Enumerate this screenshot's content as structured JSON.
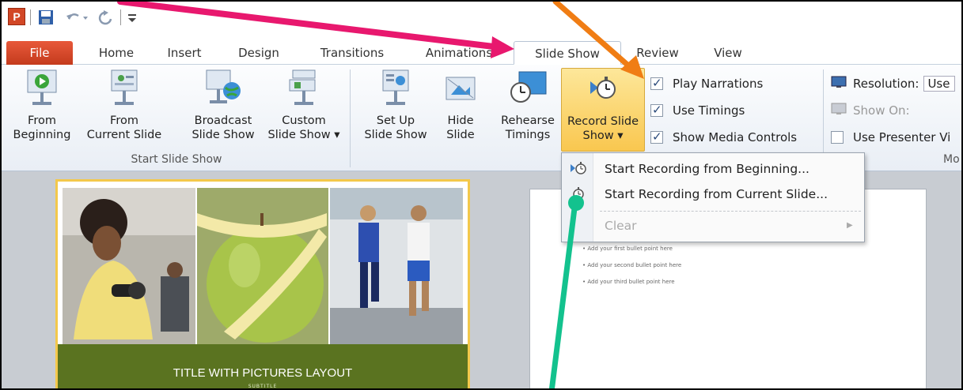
{
  "colors": {
    "arrow_pink": "#e8186e",
    "arrow_orange": "#f07d14",
    "arrow_green": "#13c28e",
    "record_highlight": "#f9c74f",
    "file_tab": "#d24726",
    "slide_banner": "#5a7320"
  },
  "qat": {
    "app_icon_letter": "P",
    "icons": [
      "powerpoint-icon",
      "save-icon",
      "undo-icon",
      "redo-icon",
      "customize-qat-icon"
    ]
  },
  "tabs": [
    {
      "label": "File"
    },
    {
      "label": "Home"
    },
    {
      "label": "Insert"
    },
    {
      "label": "Design"
    },
    {
      "label": "Transitions"
    },
    {
      "label": "Animations"
    },
    {
      "label": "Slide Show",
      "active": true
    },
    {
      "label": "Review"
    },
    {
      "label": "View"
    }
  ],
  "ribbon": {
    "start_group": {
      "label": "Start Slide Show",
      "buttons": [
        {
          "line1": "From",
          "line2": "Beginning"
        },
        {
          "line1": "From",
          "line2": "Current Slide"
        },
        {
          "line1": "Broadcast",
          "line2": "Slide Show"
        },
        {
          "line1": "Custom",
          "line2": "Slide Show ▾"
        }
      ]
    },
    "setup_group": {
      "buttons": [
        {
          "line1": "Set Up",
          "line2": "Slide Show"
        },
        {
          "line1": "Hide",
          "line2": "Slide"
        },
        {
          "line1": "Rehearse",
          "line2": "Timings"
        },
        {
          "line1": "Record Slide",
          "line2": "Show ▾"
        }
      ],
      "checkboxes": [
        {
          "label": "Play Narrations",
          "checked": true
        },
        {
          "label": "Use Timings",
          "checked": true
        },
        {
          "label": "Show Media Controls",
          "checked": true
        }
      ]
    },
    "monitors_group": {
      "resolution_label": "Resolution:",
      "resolution_value": "Use",
      "show_on_label": "Show On:",
      "presenter_label": "Use Presenter Vi",
      "group_label_partial": "Mo"
    }
  },
  "record_menu": {
    "items": [
      {
        "label": "Start Recording from Beginning...",
        "enabled": true
      },
      {
        "label": "Start Recording from Current Slide...",
        "enabled": true
      },
      {
        "label": "Clear",
        "enabled": false
      }
    ]
  },
  "slide1": {
    "title": "TITLE WITH PICTURES LAYOUT",
    "subtitle": "SUBTITLE"
  },
  "slide2": {
    "bullets": [
      "Add your first bullet point here",
      "Add your second bullet point here",
      "Add your third bullet point here"
    ]
  }
}
